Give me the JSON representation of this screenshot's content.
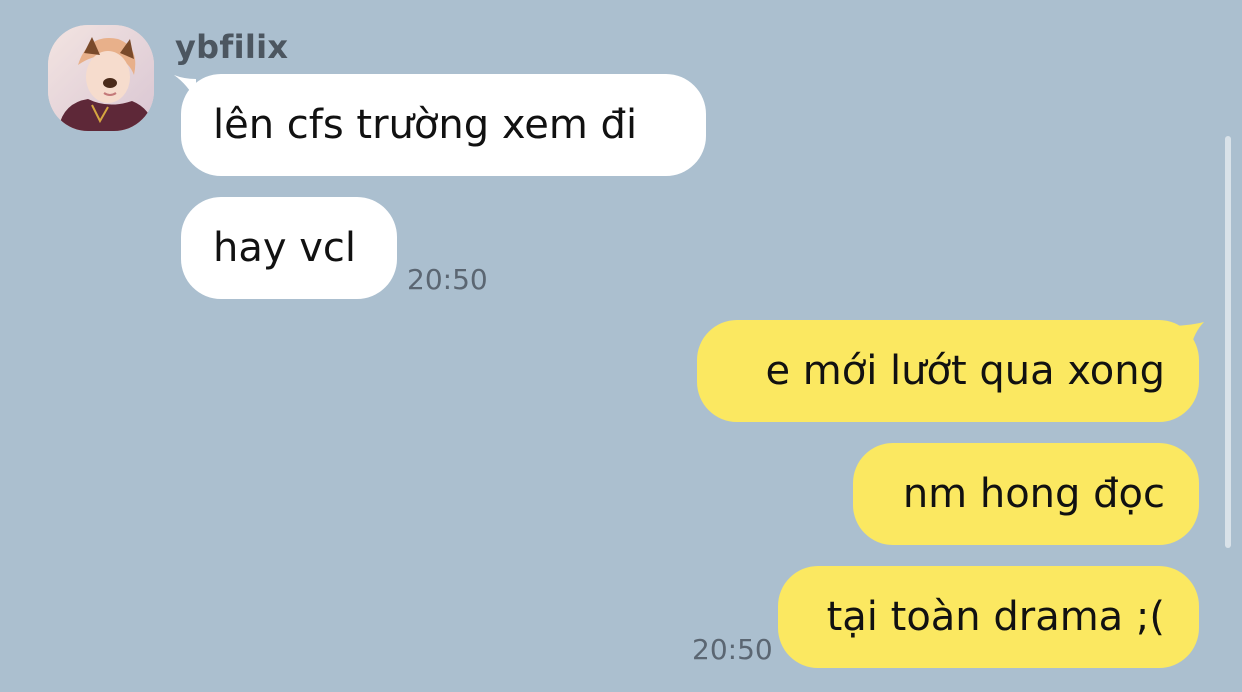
{
  "conversation": {
    "sender": {
      "name": "ybfilix",
      "avatar_icon": "user-avatar-photo"
    },
    "incoming": [
      {
        "text": "lên cfs trường xem đi"
      },
      {
        "text": "hay vcl"
      }
    ],
    "incoming_time": "20:50",
    "outgoing": [
      {
        "text": "e mới lướt qua xong"
      },
      {
        "text": "nm hong đọc"
      },
      {
        "text": "tại toàn drama ;("
      }
    ],
    "outgoing_time": "20:50"
  },
  "colors": {
    "background": "#abbfcf",
    "incoming_bubble": "#ffffff",
    "outgoing_bubble": "#fbe861",
    "sender_name": "#4c5660",
    "timestamp": "#5b6672"
  }
}
